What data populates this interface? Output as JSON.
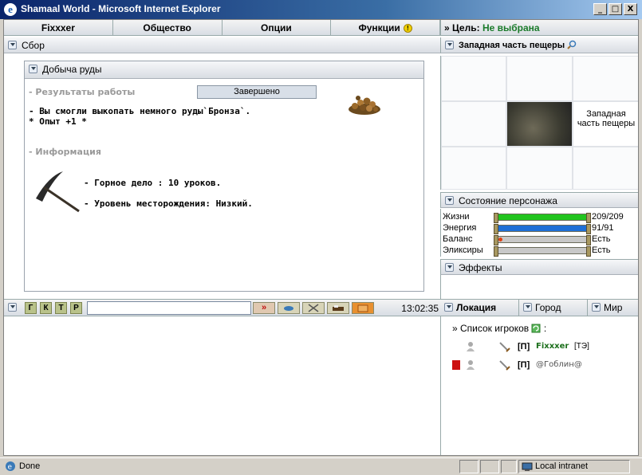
{
  "window": {
    "title": "Shamaal World - Microsoft Internet Explorer",
    "buttons": [
      "_",
      "□",
      "X"
    ]
  },
  "menu": {
    "items": [
      "Fixxxer",
      "Общество",
      "Опции",
      "Функции"
    ]
  },
  "goal": {
    "prefix": "» Цель:",
    "value": "Не выбрана"
  },
  "panels": {
    "gather": "Сбор",
    "mining": "Добыча руды"
  },
  "mining": {
    "results_label": "- Результаты работы",
    "status": "Завершено",
    "line1": "- Вы смогли выкопать немного руды`Бронза`.",
    "line2": "* Опыт +1 *",
    "info_label": "- Информация",
    "skill": "- Горное дело : 10 уроков.",
    "deposit": "- Уровень месторождения: Низкий."
  },
  "chatbar": {
    "buttons": [
      "Г",
      "К",
      "Т",
      "Р"
    ],
    "input_value": "",
    "time": "13:02:35"
  },
  "location": {
    "title": "Западная часть пещеры",
    "cell_label": "Западная часть пещеры"
  },
  "status_panel": {
    "title": "Состояние персонажа",
    "rows": [
      {
        "label": "Жизни",
        "value": "209/209",
        "fill": 1.0,
        "color": "#22c41e"
      },
      {
        "label": "Энергия",
        "value": "91/91",
        "fill": 1.0,
        "color": "#1e6fd6"
      },
      {
        "label": "Баланс",
        "value": "Есть",
        "fill": 0,
        "color": "#c8c8c8"
      },
      {
        "label": "Эликсиры",
        "value": "Есть",
        "fill": 0,
        "color": "#c8c8c8"
      }
    ]
  },
  "effects": {
    "title": "Эффекты"
  },
  "tabs": [
    "Локация",
    "Город",
    "Мир"
  ],
  "players": {
    "header": "» Список игроков",
    "list": [
      {
        "tag": "[П]",
        "name": "Fixxxer",
        "suffix": "[ТЭ]",
        "name_color": "#1a6e1a",
        "flag": false
      },
      {
        "tag": "[П]",
        "name": "@Гоблин@",
        "suffix": "",
        "name_color": "#555555",
        "flag": true
      }
    ]
  },
  "statusbar": {
    "text": "Done",
    "zone": "Local intranet"
  }
}
